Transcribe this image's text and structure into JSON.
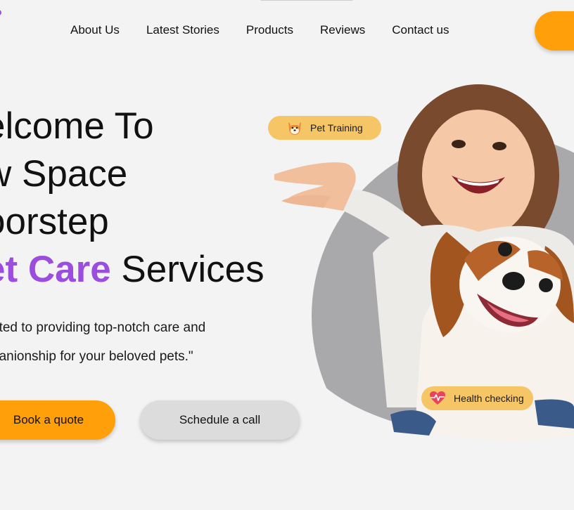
{
  "nav": {
    "items": [
      {
        "label": "About Us"
      },
      {
        "label": "Latest Stories"
      },
      {
        "label": "Products"
      },
      {
        "label": "Reviews"
      },
      {
        "label": "Contact us"
      }
    ]
  },
  "hero": {
    "title_line1": "elcome To",
    "title_line2": "w Space",
    "title_line3": "oorstep",
    "title_accent": "et Care",
    "title_rest": " Services",
    "desc_line1": "ated to providing top-notch care and",
    "desc_line2": "nanionship for your beloved pets.\"",
    "primary_button": "Book a quote",
    "secondary_button": "Schedule a call"
  },
  "badges": {
    "training": "Pet Training",
    "health": "Health checking"
  },
  "colors": {
    "accent_purple": "#9b4de0",
    "accent_orange": "#ff9f0a",
    "badge_yellow": "#f6c566",
    "background": "#f3f3f4"
  },
  "icons": {
    "training": "shiba-dog-face-icon",
    "health": "heart-pulse-icon"
  }
}
